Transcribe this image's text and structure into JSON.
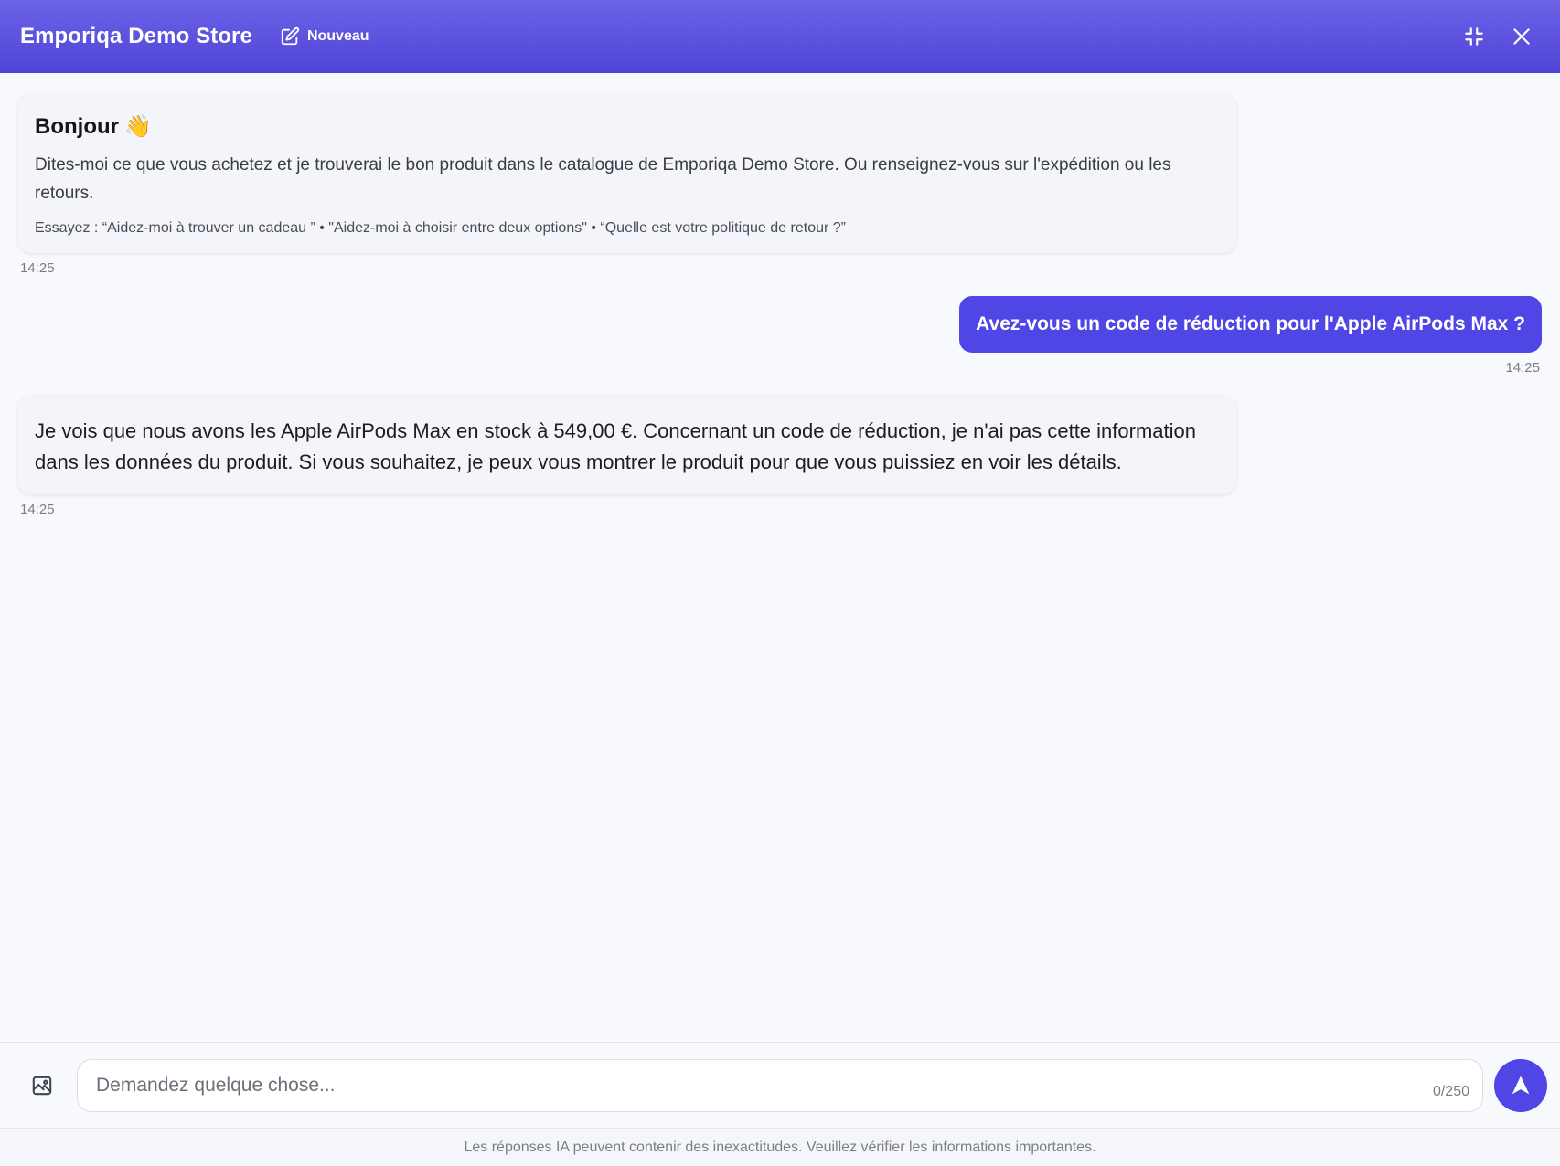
{
  "header": {
    "title": "Emporiqa Demo Store",
    "new_label": "Nouveau",
    "icons": {
      "new": "edit-icon",
      "minimize": "collapse-icon",
      "close": "close-icon"
    },
    "gradient_colors": [
      "#6c63e8",
      "#4f44d6"
    ]
  },
  "messages": [
    {
      "role": "assistant",
      "type": "welcome",
      "title": "Bonjour",
      "title_emoji": "👋",
      "text": "Dites-moi ce que vous achetez et je trouverai le bon produit dans le catalogue de Emporiqa Demo Store. Ou renseignez-vous sur l'expédition ou les retours.",
      "suggestions": "Essayez : “Aidez-moi à trouver un cadeau ” • \"Aidez-moi à choisir entre deux options\" • “Quelle est votre politique de retour ?”",
      "time": "14:25"
    },
    {
      "role": "user",
      "text": "Avez-vous un code de réduction pour l'Apple AirPods Max ?",
      "time": "14:25"
    },
    {
      "role": "assistant",
      "text": "Je vois que nous avons les Apple AirPods Max en stock à 549,00 €. Concernant un code de réduction, je n'ai pas cette information dans les données du produit. Si vous souhaitez, je peux vous montrer le produit pour que vous puissiez en voir les détails.",
      "time": "14:25"
    }
  ],
  "composer": {
    "placeholder": "Demandez quelque chose...",
    "value": "",
    "char_count": "0/250",
    "icons": {
      "attach": "image-icon",
      "send": "send-icon"
    },
    "accent_color": "#4f46e5"
  },
  "footer": {
    "disclaimer": "Les réponses IA peuvent contenir des inexactitudes. Veuillez vérifier les informations importantes."
  }
}
